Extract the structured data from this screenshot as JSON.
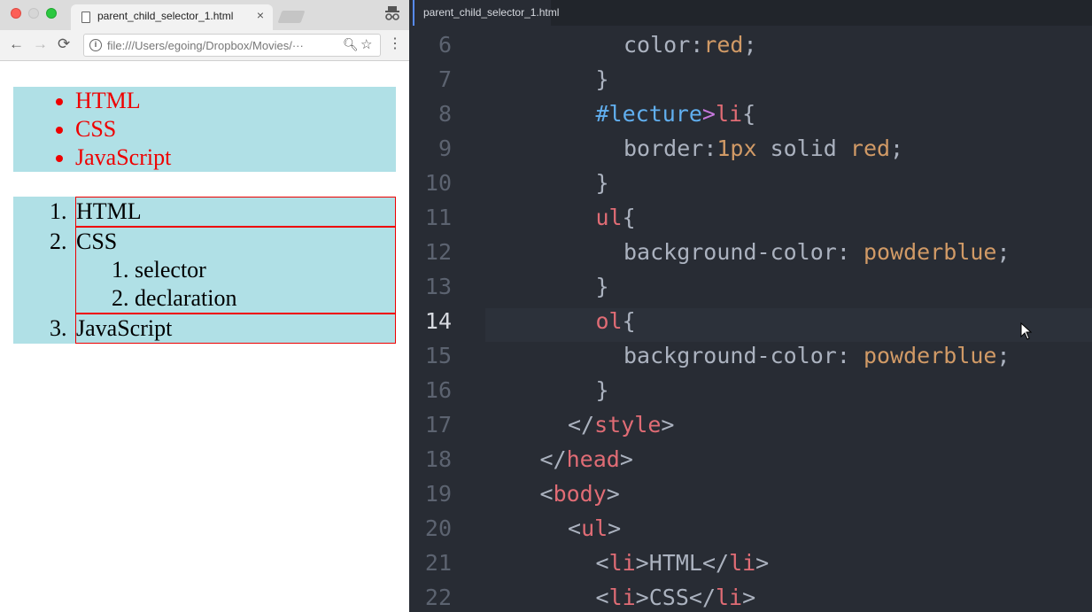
{
  "browser": {
    "tab_title": "parent_child_selector_1.html",
    "tab_close": "×",
    "url": "file:///Users/egoing/Dropbox/Movies/···",
    "icons": {
      "back": "back-arrow-icon",
      "forward": "forward-arrow-icon",
      "reload": "reload-icon",
      "info": "info-icon",
      "zoom": "zoom-icon",
      "bookmark": "star-icon",
      "menu": "kebab-menu-icon",
      "incognito": "incognito-icon"
    },
    "page": {
      "ul_items": [
        "HTML",
        "CSS",
        "JavaScript"
      ],
      "ol_items": [
        {
          "num": "1.",
          "text": "HTML"
        },
        {
          "num": "2.",
          "text": "CSS",
          "children": [
            {
              "num": "1.",
              "text": "selector"
            },
            {
              "num": "2.",
              "text": "declaration"
            }
          ]
        },
        {
          "num": "3.",
          "text": "JavaScript"
        }
      ],
      "colors": {
        "powderblue": "#b0e0e6",
        "red": "#ee0000"
      }
    }
  },
  "editor": {
    "tab_title": "parent_child_selector_1.html",
    "current_line": 14,
    "lines": [
      {
        "n": "6",
        "indent": 4,
        "tokens": [
          [
            "prop",
            "color"
          ],
          [
            "punc",
            ":"
          ],
          [
            "val",
            "red"
          ],
          [
            "punc",
            ";"
          ]
        ]
      },
      {
        "n": "7",
        "indent": 3,
        "tokens": [
          [
            "punc",
            "}"
          ]
        ]
      },
      {
        "n": "8",
        "indent": 3,
        "tokens": [
          [
            "id",
            "#lecture"
          ],
          [
            "comb",
            ">"
          ],
          [
            "tag",
            "li"
          ],
          [
            "punc",
            "{"
          ]
        ]
      },
      {
        "n": "9",
        "indent": 4,
        "tokens": [
          [
            "prop",
            "border"
          ],
          [
            "punc",
            ":"
          ],
          [
            "val",
            "1px"
          ],
          [
            "text",
            " solid "
          ],
          [
            "val",
            "red"
          ],
          [
            "punc",
            ";"
          ]
        ]
      },
      {
        "n": "10",
        "indent": 3,
        "tokens": [
          [
            "punc",
            "}"
          ]
        ]
      },
      {
        "n": "11",
        "indent": 3,
        "tokens": [
          [
            "tag",
            "ul"
          ],
          [
            "punc",
            "{"
          ]
        ]
      },
      {
        "n": "12",
        "indent": 4,
        "tokens": [
          [
            "prop",
            "background-color"
          ],
          [
            "punc",
            ": "
          ],
          [
            "val",
            "powderblue"
          ],
          [
            "punc",
            ";"
          ]
        ]
      },
      {
        "n": "13",
        "indent": 3,
        "tokens": [
          [
            "punc",
            "}"
          ]
        ]
      },
      {
        "n": "14",
        "indent": 3,
        "tokens": [
          [
            "tag",
            "ol"
          ],
          [
            "punc",
            "{"
          ]
        ]
      },
      {
        "n": "15",
        "indent": 4,
        "tokens": [
          [
            "prop",
            "background-color"
          ],
          [
            "punc",
            ": "
          ],
          [
            "val",
            "powderblue"
          ],
          [
            "punc",
            ";"
          ]
        ]
      },
      {
        "n": "16",
        "indent": 3,
        "tokens": [
          [
            "punc",
            "}"
          ]
        ]
      },
      {
        "n": "17",
        "indent": 2,
        "tokens": [
          [
            "punc",
            "</"
          ],
          [
            "tag",
            "style"
          ],
          [
            "punc",
            ">"
          ]
        ]
      },
      {
        "n": "18",
        "indent": 1,
        "tokens": [
          [
            "punc",
            "</"
          ],
          [
            "tag",
            "head"
          ],
          [
            "punc",
            ">"
          ]
        ]
      },
      {
        "n": "19",
        "indent": 1,
        "tokens": [
          [
            "punc",
            "<"
          ],
          [
            "tag",
            "body"
          ],
          [
            "punc",
            ">"
          ]
        ]
      },
      {
        "n": "20",
        "indent": 2,
        "tokens": [
          [
            "punc",
            "<"
          ],
          [
            "tag",
            "ul"
          ],
          [
            "punc",
            ">"
          ]
        ]
      },
      {
        "n": "21",
        "indent": 3,
        "tokens": [
          [
            "punc",
            "<"
          ],
          [
            "tag",
            "li"
          ],
          [
            "punc",
            ">"
          ],
          [
            "text",
            "HTML"
          ],
          [
            "punc",
            "</"
          ],
          [
            "tag",
            "li"
          ],
          [
            "punc",
            ">"
          ]
        ]
      },
      {
        "n": "22",
        "indent": 3,
        "tokens": [
          [
            "punc",
            "<"
          ],
          [
            "tag",
            "li"
          ],
          [
            "punc",
            ">"
          ],
          [
            "text",
            "CSS"
          ],
          [
            "punc",
            "</"
          ],
          [
            "tag",
            "li"
          ],
          [
            "punc",
            ">"
          ]
        ]
      }
    ],
    "colors": {
      "background": "#282c34",
      "keyword": "#e06c75",
      "value": "#d19a66",
      "id": "#61afef"
    }
  }
}
